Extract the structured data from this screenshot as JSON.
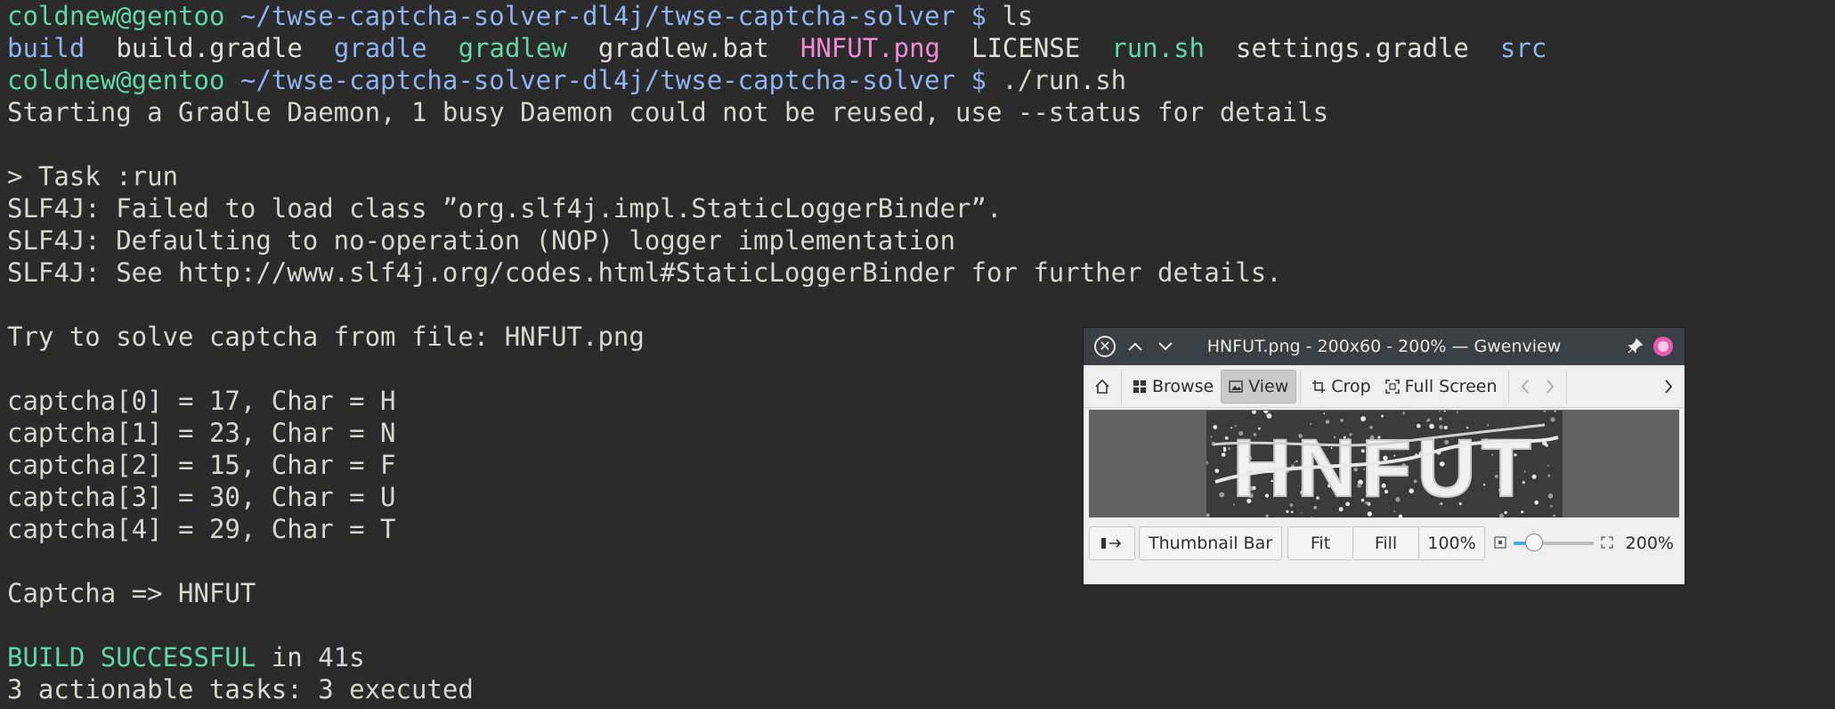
{
  "terminal": {
    "prompt_user": "coldnew@gentoo",
    "prompt_path": "~/twse-captcha-solver-dl4j/twse-captcha-solver",
    "prompt_symbol": "$",
    "cmd1": "ls",
    "ls_entries": [
      {
        "name": "build",
        "color": "#8eb4f2"
      },
      {
        "name": "build.gradle",
        "color": "#e0e0dc"
      },
      {
        "name": "gradle",
        "color": "#8eb4f2"
      },
      {
        "name": "gradlew",
        "color": "#5fd7a7"
      },
      {
        "name": "gradlew.bat",
        "color": "#e0e0dc"
      },
      {
        "name": "HNFUT.png",
        "color": "#f08bd7"
      },
      {
        "name": "LICENSE",
        "color": "#e0e0dc"
      },
      {
        "name": "run.sh",
        "color": "#5fd7a7"
      },
      {
        "name": "settings.gradle",
        "color": "#e0e0dc"
      },
      {
        "name": "src",
        "color": "#8eb4f2"
      }
    ],
    "cmd2": "./run.sh",
    "daemon": "Starting a Gradle Daemon, 1 busy Daemon could not be reused, use --status for details",
    "task": "> Task :run",
    "slf1": "SLF4J: Failed to load class ”org.slf4j.impl.StaticLoggerBinder”.",
    "slf2": "SLF4J: Defaulting to no-operation (NOP) logger implementation",
    "slf3": "SLF4J: See http://www.slf4j.org/codes.html#StaticLoggerBinder for further details.",
    "try": "Try to solve captcha from file: HNFUT.png",
    "captcha": [
      "captcha[0] = 17, Char = H",
      "captcha[1] = 23, Char = N",
      "captcha[2] = 15, Char = F",
      "captcha[3] = 30, Char = U",
      "captcha[4] = 29, Char = T"
    ],
    "result": "Captcha => HNFUT",
    "build_status": "BUILD SUCCESSFUL",
    "build_time": " in 41s",
    "tasks": "3 actionable tasks: 3 executed"
  },
  "gwenview": {
    "title": "HNFUT.png - 200x60 - 200% — Gwenview",
    "toolbar": {
      "browse": "Browse",
      "view": "View",
      "crop": "Crop",
      "fullscreen": "Full Screen"
    },
    "image_text": "HNFUT",
    "statusbar": {
      "thumbnail_bar": "Thumbnail Bar",
      "fit": "Fit",
      "fill": "Fill",
      "hundred": "100%",
      "zoom": "200%",
      "zoom_slider_fraction": 0.25
    }
  }
}
